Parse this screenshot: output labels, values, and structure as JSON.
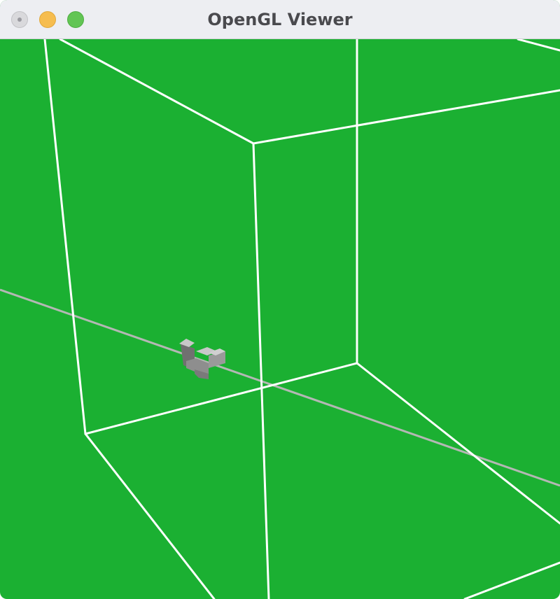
{
  "window": {
    "title": "OpenGL Viewer"
  },
  "viewport": {
    "background_color": "#1bb032",
    "wireframe_color": "#ffffff",
    "axis_line_color": "#b4b8b4",
    "object_colors": {
      "light": "#c8c8c8",
      "mid": "#9a9a9a",
      "dark": "#707070"
    }
  },
  "icons": {
    "close": "close-icon",
    "minimize": "minimize-icon",
    "zoom": "zoom-icon"
  }
}
